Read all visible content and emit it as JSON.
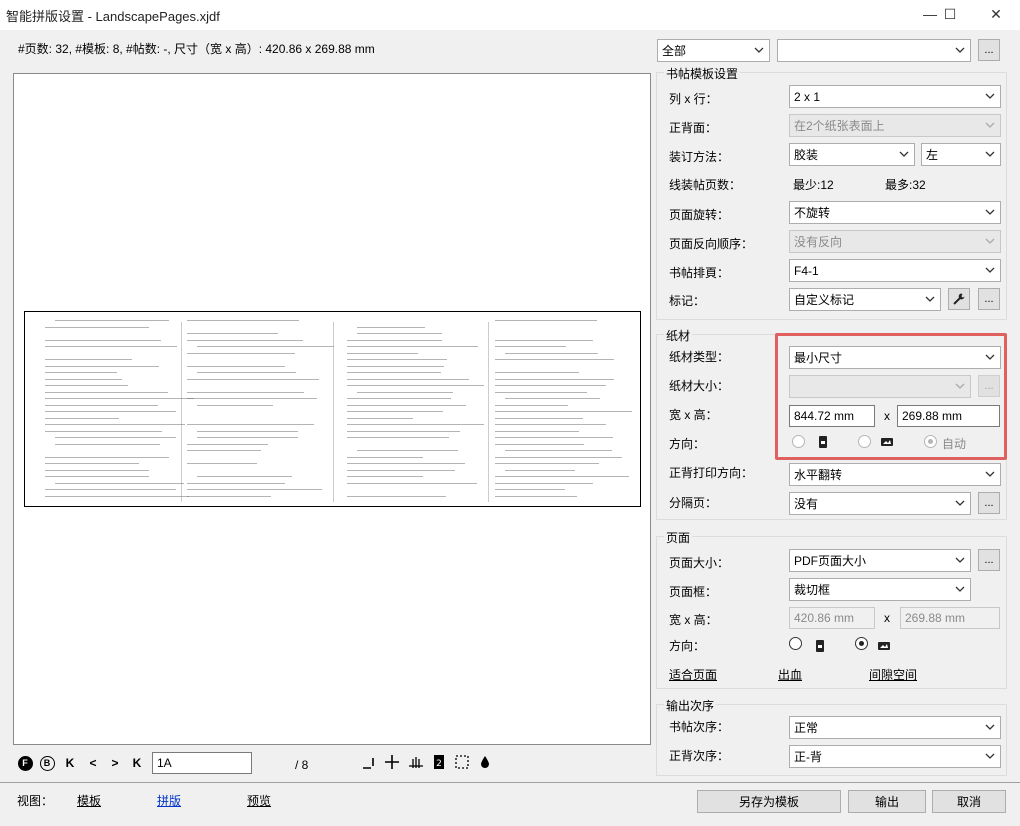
{
  "window": {
    "title": "智能拼版设置 - LandscapePages.xjdf",
    "min": "—",
    "max": "☐",
    "close": "✕"
  },
  "info": "#页数: 32, #模板: 8, #帖数: -, 尺寸（宽 x 高）: 420.86 x 269.88 mm",
  "top_filter": {
    "scope": "全部",
    "item": "",
    "more": "..."
  },
  "signature": {
    "group_label": "书帖模板设置",
    "cols_rows_label": "列 x 行：",
    "cols_rows": "2 x 1",
    "sides_label": "正背面：",
    "sides": "在2个纸张表面上",
    "binding_label": "装订方法：",
    "binding": "胶装",
    "binding_side": "左",
    "pages_label": "线装帖页数：",
    "min": "最少:12",
    "max": "最多:32",
    "rotation_label": "页面旋转：",
    "rotation": "不旋转",
    "reverse_label": "页面反向顺序：",
    "reverse": "没有反向",
    "scheme_label": "书帖排頁：",
    "scheme": "F4-1",
    "marks_label": "标记：",
    "marks": "自定义标记",
    "marks_more": "..."
  },
  "media": {
    "group_label": "纸材",
    "type_label": "纸材类型：",
    "type": "最小尺寸",
    "size_label": "纸材大小：",
    "size": "",
    "size_more": "...",
    "wh_label": "宽 x 高：",
    "width": "844.72 mm",
    "x": "x",
    "height": "269.88 mm",
    "orient_label": "方向：",
    "auto": "自动",
    "workstyle_label": "正背打印方向：",
    "workstyle": "水平翻转",
    "separator_label": "分隔页：",
    "separator": "没有",
    "separator_more": "..."
  },
  "page": {
    "group_label": "页面",
    "size_label": "页面大小：",
    "size": "PDF页面大小",
    "size_more": "...",
    "box_label": "页面框：",
    "box": "裁切框",
    "wh_label": "宽 x 高：",
    "width": "420.86 mm",
    "x": "x",
    "height": "269.88 mm",
    "orient_label": "方向：",
    "fit": "适合页面",
    "bleed": "出血",
    "gap": "间隙空间"
  },
  "output": {
    "group_label": "输出次序",
    "sig_order_label": "书帖次序：",
    "sig_order": "正常",
    "side_order_label": "正背次序：",
    "side_order": "正-背"
  },
  "toolbar": {
    "front": "F",
    "back": "B",
    "first": "K",
    "prev": "<",
    "next": ">",
    "last": "K",
    "sheet_input": "1A",
    "total": "/ 8"
  },
  "footer": {
    "view_label": "视图：",
    "tab_template": "模板",
    "tab_imposition": "拼版",
    "tab_preview": "预览",
    "save_template": "另存为模板",
    "output": "输出",
    "cancel": "取消"
  }
}
